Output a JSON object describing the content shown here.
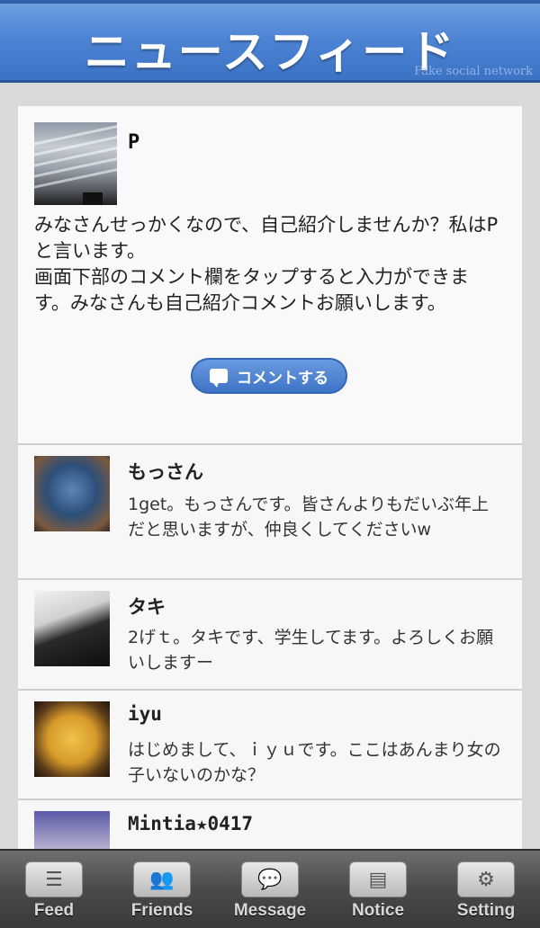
{
  "header": {
    "title": "ニュースフィード",
    "tagline": "Fake social network"
  },
  "post": {
    "author": "P",
    "body": "みなさんせっかくなので、自己紹介しませんか？私はPと言います。\n画面下部のコメント欄をタップすると入力ができます。みなさんも自己紹介コメントお願いします。",
    "comment_button": "コメントする"
  },
  "comments": [
    {
      "name": "もっさん",
      "text": "1get。もっさんです。皆さんよりもだいぶ年上だと思いますが、仲良くしてくださいw"
    },
    {
      "name": "タキ",
      "text": "2げｔ。タキです、学生してます。よろしくお願いしますー"
    },
    {
      "name": "iyu",
      "text": "はじめまして、ｉｙｕです。ここはあんまり女の子いないのかな？"
    },
    {
      "name": "Mintia★0417",
      "text": ""
    }
  ],
  "tabs": [
    {
      "label": "Feed",
      "icon": "feed-icon"
    },
    {
      "label": "Friends",
      "icon": "friends-icon"
    },
    {
      "label": "Message",
      "icon": "message-icon"
    },
    {
      "label": "Notice",
      "icon": "notice-icon"
    },
    {
      "label": "Setting",
      "icon": "setting-icon"
    }
  ],
  "colors": {
    "header_blue": "#4d84d4",
    "button_blue": "#3e73c6",
    "tabbar_gray": "#4a4a4a"
  }
}
